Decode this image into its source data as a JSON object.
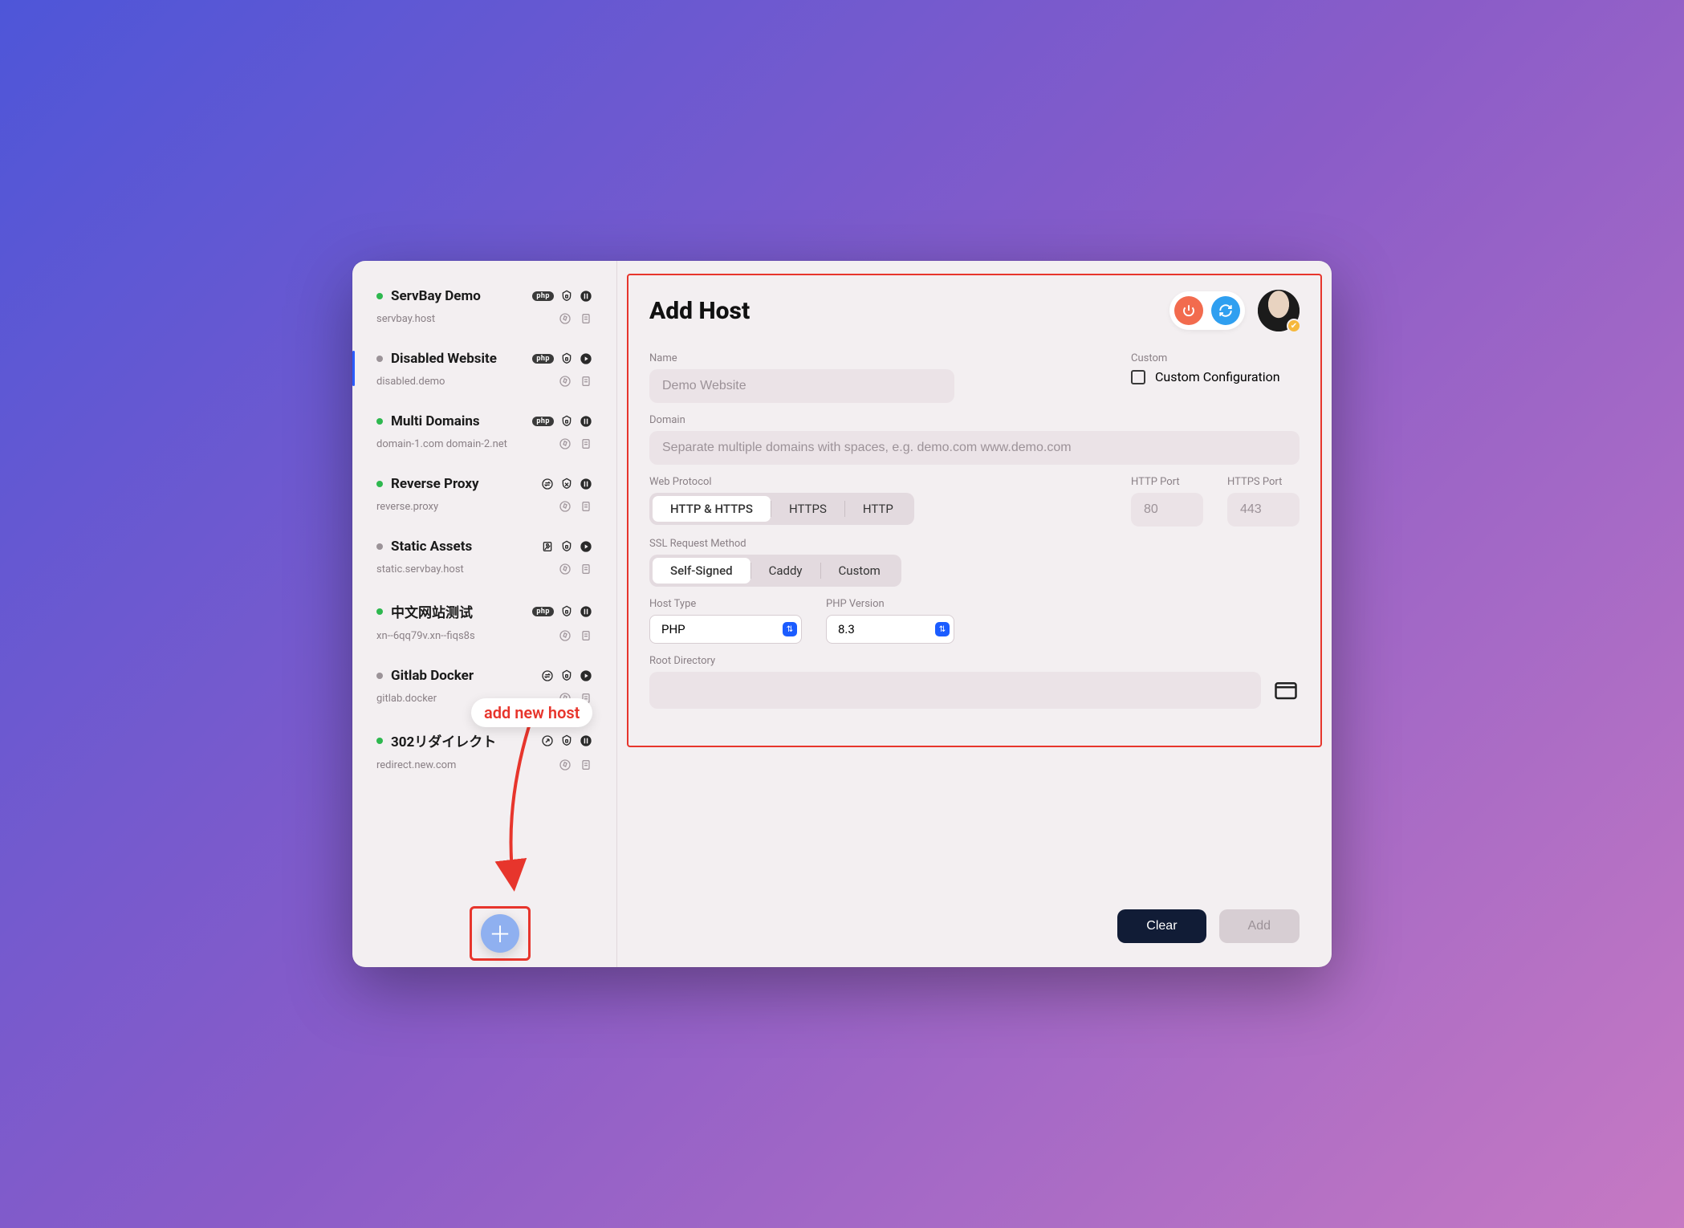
{
  "sidebar": {
    "items": [
      {
        "name": "ServBay Demo",
        "sub": "servbay.host",
        "status": "green",
        "badge": "php",
        "shield": "lock",
        "action": "pause"
      },
      {
        "name": "Disabled Website",
        "sub": "disabled.demo",
        "status": "grey",
        "badge": "php",
        "shield": "lock",
        "action": "play"
      },
      {
        "name": "Multi Domains",
        "sub": "domain-1.com domain-2.net",
        "status": "green",
        "badge": "php",
        "shield": "lock",
        "action": "pause"
      },
      {
        "name": "Reverse Proxy",
        "sub": "reverse.proxy",
        "status": "green",
        "badge": "swap",
        "shield": "xshield",
        "action": "pause"
      },
      {
        "name": "Static Assets",
        "sub": "static.servbay.host",
        "status": "grey",
        "badge": "static",
        "shield": "lock",
        "action": "play"
      },
      {
        "name": "中文网站测试",
        "sub": "xn--6qq79v.xn--fiqs8s",
        "status": "green",
        "badge": "php",
        "shield": "lock",
        "action": "pause"
      },
      {
        "name": "Gitlab Docker",
        "sub": "gitlab.docker",
        "status": "grey",
        "badge": "swap",
        "shield": "lock",
        "action": "play"
      },
      {
        "name": "302リダイレクト",
        "sub": "redirect.new.com",
        "status": "green",
        "badge": "redirect",
        "shield": "lock",
        "action": "pause"
      }
    ],
    "selected_index": 1
  },
  "callout": {
    "label": "add new host"
  },
  "header": {
    "title": "Add Host"
  },
  "form": {
    "name_label": "Name",
    "name_placeholder": "Demo Website",
    "domain_label": "Domain",
    "domain_placeholder": "Separate multiple domains with spaces, e.g. demo.com www.demo.com",
    "protocol_label": "Web Protocol",
    "protocol_options": [
      "HTTP & HTTPS",
      "HTTPS",
      "HTTP"
    ],
    "protocol_selected": 0,
    "http_port_label": "HTTP Port",
    "http_port_placeholder": "80",
    "https_port_label": "HTTPS Port",
    "https_port_placeholder": "443",
    "ssl_label": "SSL Request Method",
    "ssl_options": [
      "Self-Signed",
      "Caddy",
      "Custom"
    ],
    "ssl_selected": 0,
    "host_type_label": "Host Type",
    "host_type_value": "PHP",
    "php_version_label": "PHP Version",
    "php_version_value": "8.3",
    "root_label": "Root Directory",
    "custom_label": "Custom",
    "custom_config_label": "Custom Configuration"
  },
  "footer": {
    "clear": "Clear",
    "add": "Add"
  }
}
